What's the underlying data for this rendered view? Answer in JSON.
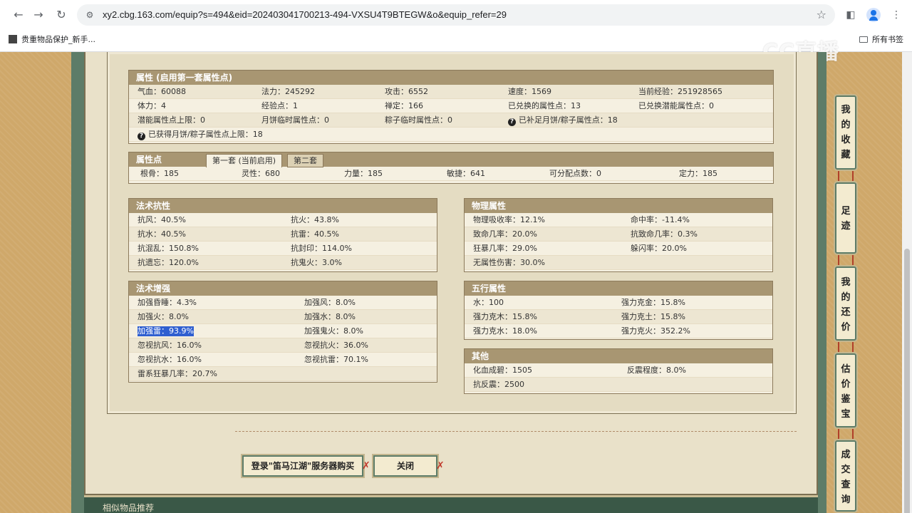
{
  "browser": {
    "url": "xy2.cbg.163.com/equip?s=494&eid=202403041700213-494-VXSU4T9BTEGW&o&equip_refer=29",
    "bookmark": "贵重物品保护_新手...",
    "all_bookmarks": "所有书签"
  },
  "watermark": "CC直播",
  "attributes": {
    "title": "属性 (启用第一套属性点)",
    "row1": [
      "气血：60088",
      "法力：245292",
      "攻击：6552",
      "速度：1569",
      "当前经验：251928565"
    ],
    "row2": [
      "体力：4",
      "经验点：1",
      "禅定：166",
      "已兑换的属性点：13",
      "已兑换潜能属性点：0"
    ],
    "row3": [
      "潜能属性点上限：0",
      "月饼临时属性点：0",
      "粽子临时属性点：0",
      "已补足月饼/粽子属性点：18"
    ],
    "row4": [
      "已获得月饼/粽子属性点上限：18"
    ]
  },
  "points": {
    "title": "属性点",
    "tab1": "第一套 (当前启用)",
    "tab2": "第二套",
    "values": [
      "根骨：185",
      "灵性：680",
      "力量：185",
      "敏捷：641",
      "可分配点数：0",
      "定力：185"
    ]
  },
  "spell_resist": {
    "title": "法术抗性",
    "rows": [
      [
        "抗风：40.5%",
        "抗火：43.8%"
      ],
      [
        "抗水：40.5%",
        "抗雷：40.5%"
      ],
      [
        "抗混乱：150.8%",
        "抗封印：114.0%"
      ],
      [
        "抗遗忘：120.0%",
        "抗鬼火：3.0%"
      ]
    ]
  },
  "physical": {
    "title": "物理属性",
    "rows": [
      [
        "物理吸收率：12.1%",
        "命中率：-11.4%"
      ],
      [
        "致命几率：20.0%",
        "抗致命几率：0.3%"
      ],
      [
        "狂暴几率：29.0%",
        "躲闪率：20.0%"
      ],
      [
        "无属性伤害：30.0%",
        ""
      ]
    ]
  },
  "spell_boost": {
    "title": "法术增强",
    "rows": [
      [
        "加强昏睡：4.3%",
        "加强风：8.0%"
      ],
      [
        "加强火：8.0%",
        "加强水：8.0%"
      ],
      [
        "加强雷：93.9%",
        "加强鬼火：8.0%"
      ],
      [
        "忽视抗风：16.0%",
        "忽视抗火：36.0%"
      ],
      [
        "忽视抗水：16.0%",
        "忽视抗雷：70.1%"
      ],
      [
        "雷系狂暴几率：20.7%",
        ""
      ]
    ]
  },
  "five_elements": {
    "title": "五行属性",
    "rows": [
      [
        "水：100",
        "强力克金：15.8%"
      ],
      [
        "强力克木：15.8%",
        "强力克土：15.8%"
      ],
      [
        "强力克水：18.0%",
        "强力克火：352.2%"
      ]
    ]
  },
  "other": {
    "title": "其他",
    "rows": [
      [
        "化血成碧：1505",
        "反震程度：8.0%"
      ],
      [
        "抗反震：2500",
        ""
      ]
    ]
  },
  "buttons": {
    "login": "登录\"笛马江湖\"服务器购买",
    "close": "关闭"
  },
  "side_tabs": [
    "我的收藏",
    "足迹",
    "我的还价",
    "估价鉴宝",
    "成交查询"
  ],
  "bottom_strip": "相似物品推荐"
}
